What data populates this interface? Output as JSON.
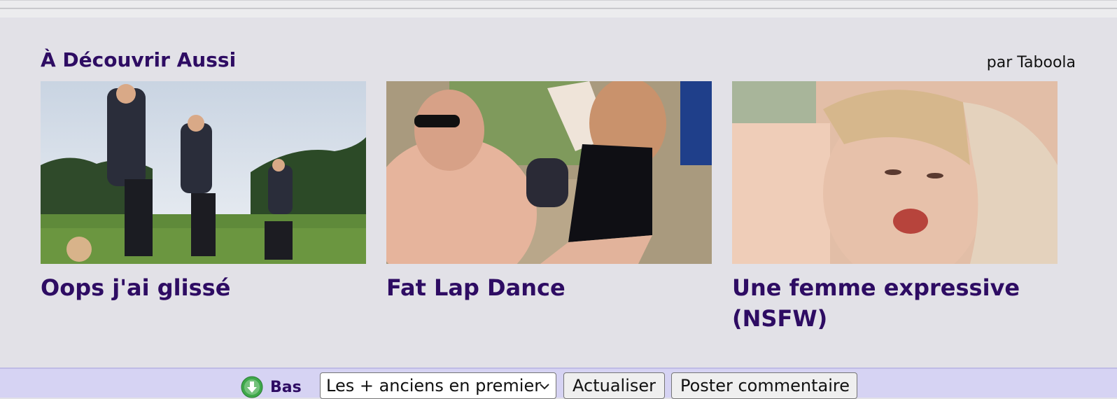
{
  "section": {
    "title": "À Découvrir Aussi",
    "attribution": "par Taboola"
  },
  "cards": [
    {
      "title": "Oops j'ai glissé",
      "thumbnail": "cheerleaders-stunt-photo"
    },
    {
      "title": "Fat Lap Dance",
      "thumbnail": "lap-dance-photo"
    },
    {
      "title": "Une femme expressive (NSFW)",
      "thumbnail": "expressive-woman-photo"
    }
  ],
  "bottom_bar": {
    "down_icon": "down-arrow-circle-icon",
    "down_label": "Bas",
    "sort_select_value": "Les + anciens en premier",
    "refresh_label": "Actualiser",
    "post_comment_label": "Poster commentaire"
  },
  "colors": {
    "title": "#2e0c63",
    "widget_background": "#e2e1e7",
    "bottom_bar_background": "#d6d3f3"
  }
}
